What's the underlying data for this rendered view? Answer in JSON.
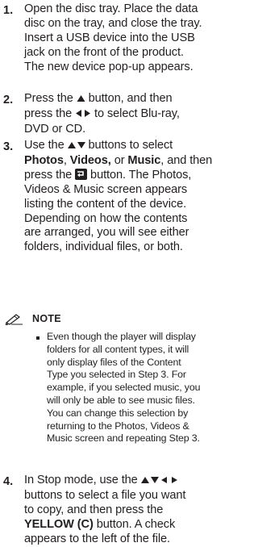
{
  "steps": [
    {
      "num": "1.",
      "lines": [
        "Open the disc tray. Place the data",
        "disc on the tray, and close the tray.",
        "Insert a USB device into the USB",
        "jack on the front of the product.",
        "The new device pop-up appears."
      ]
    },
    {
      "num": "2.",
      "line1_a": "Press the ",
      "line1_b": " button, and then",
      "line2_a": "press the ",
      "line2_b": " to select Blu-ray,",
      "line3": "DVD or CD."
    },
    {
      "num": "3.",
      "line1_a": "Use the ",
      "line1_b": " buttons to select",
      "photos": "Photos",
      "sep1": ", ",
      "videos": "Videos,",
      "or": " or ",
      "music": "Music",
      "line2_tail": ", and then",
      "line3_a": "press the ",
      "line3_b": " button. The Photos,",
      "lines_rest": [
        "Videos & Music screen appears",
        "listing the content of the device.",
        "Depending on how the contents",
        "are arranged, you will see either",
        "folders, individual files, or both."
      ]
    },
    {
      "num": "4.",
      "line1_a": "In Stop mode, use the ",
      "line2": "buttons to select a file you want",
      "line3": "to copy, and then press the",
      "yellow": "YELLOW (C)",
      "line4_tail": " button. A check",
      "line5": "appears to the left of the file."
    }
  ],
  "note": {
    "icon": "pencil-note-icon",
    "label": "NOTE",
    "lines": [
      "Even though the player will display",
      "folders for all content types, it will",
      "only display files of the Content",
      "Type you selected in Step 3. For",
      "example, if you selected music, you",
      "will only be able to see music files.",
      "You can change this selection by",
      "returning to the Photos, Videos &",
      "Music screen and repeating Step 3."
    ]
  },
  "colors": {
    "text": "#231f20"
  }
}
